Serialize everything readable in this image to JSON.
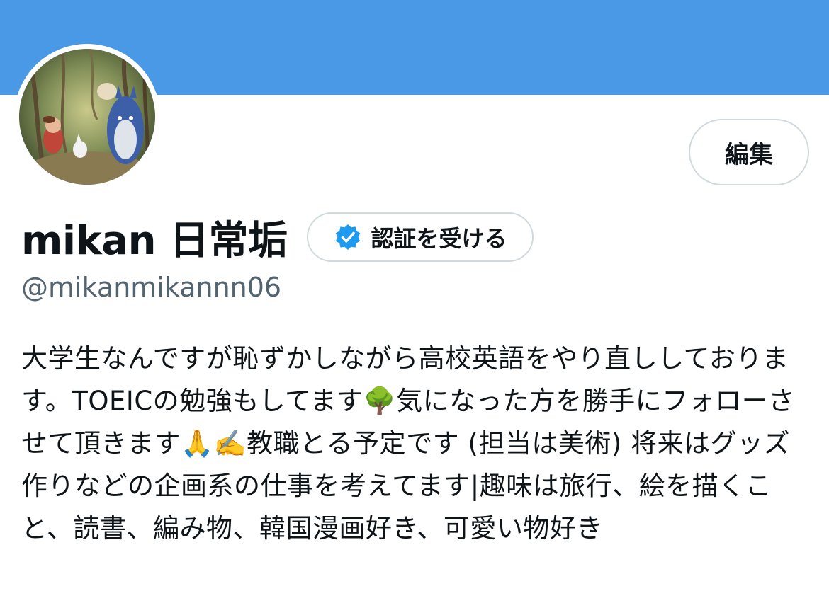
{
  "profile": {
    "banner_color": "#4a99e6",
    "avatar_label": "avatar",
    "edit_label": "編集",
    "display_name": "mikan 日常垢",
    "verify_label": "認証を受ける",
    "verify_icon": "verified-badge-icon",
    "verify_color": "#1d9bf0",
    "handle": "@mikanmikannn06",
    "bio": "大学生なんですが恥ずかしながら高校英語をやり直ししております。TOEICの勉強もしてます🌳気になった方を勝手にフォローさせて頂きます🙏✍️教職とる予定です (担当は美術) 将来はグッズ作りなどの企画系の仕事を考えてます|趣味は旅行、絵を描くこと、読書、編み物、韓国漫画好き、可愛い物好き"
  }
}
